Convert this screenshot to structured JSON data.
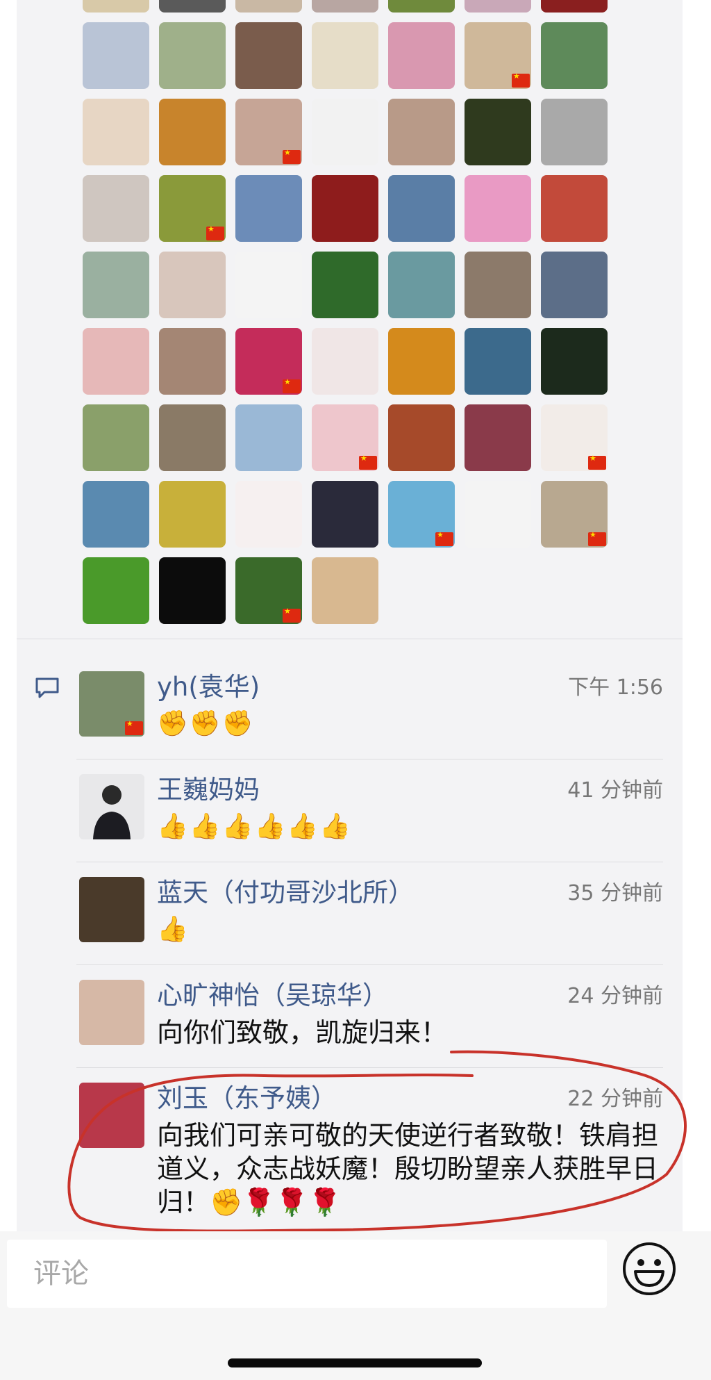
{
  "likes": {
    "avatars": [
      {
        "icon": "user-avatar",
        "bg": "#d8c9a8",
        "flag": false
      },
      {
        "icon": "user-avatar",
        "bg": "#5a5a5a",
        "flag": false
      },
      {
        "icon": "user-avatar",
        "bg": "#c9b8a4",
        "flag": false
      },
      {
        "icon": "user-avatar",
        "bg": "#b8a6a2",
        "flag": false
      },
      {
        "icon": "user-avatar",
        "bg": "#6f8a3c",
        "flag": false
      },
      {
        "icon": "user-avatar",
        "bg": "#c9a8b8",
        "flag": false
      },
      {
        "icon": "user-avatar",
        "bg": "#8a1f1f",
        "flag": false
      },
      {
        "icon": "user-avatar",
        "bg": "#b9c4d6",
        "flag": false
      },
      {
        "icon": "user-avatar",
        "bg": "#9fb08a",
        "flag": false
      },
      {
        "icon": "user-avatar",
        "bg": "#7a5c4c",
        "flag": false
      },
      {
        "icon": "user-avatar",
        "bg": "#e6ddc8",
        "flag": false
      },
      {
        "icon": "user-avatar",
        "bg": "#d998b0",
        "flag": false
      },
      {
        "icon": "user-avatar",
        "bg": "#cfb89a",
        "flag": true
      },
      {
        "icon": "user-avatar",
        "bg": "#5e8a5a",
        "flag": false
      },
      {
        "icon": "user-avatar",
        "bg": "#e7d6c4",
        "flag": false
      },
      {
        "icon": "user-avatar",
        "bg": "#c8842c",
        "flag": false
      },
      {
        "icon": "user-avatar",
        "bg": "#c6a596",
        "flag": true
      },
      {
        "icon": "user-avatar",
        "bg": "#f2f2f2",
        "flag": false
      },
      {
        "icon": "user-avatar",
        "bg": "#b89a88",
        "flag": false
      },
      {
        "icon": "user-avatar",
        "bg": "#2f3a1e",
        "flag": false
      },
      {
        "icon": "user-avatar",
        "bg": "#a9a9a9",
        "flag": false
      },
      {
        "icon": "user-avatar",
        "bg": "#cfc6c0",
        "flag": false
      },
      {
        "icon": "user-avatar",
        "bg": "#8a9a3a",
        "flag": true
      },
      {
        "icon": "user-avatar",
        "bg": "#6c8cb8",
        "flag": false
      },
      {
        "icon": "user-avatar",
        "bg": "#8e1c1c",
        "flag": false
      },
      {
        "icon": "user-avatar",
        "bg": "#5a7ea6",
        "flag": false
      },
      {
        "icon": "user-avatar",
        "bg": "#e99ac4",
        "flag": false
      },
      {
        "icon": "user-avatar",
        "bg": "#c24a3a",
        "flag": false
      },
      {
        "icon": "user-avatar",
        "bg": "#9ab0a0",
        "flag": false
      },
      {
        "icon": "user-avatar",
        "bg": "#d8c6bc",
        "flag": false
      },
      {
        "icon": "user-avatar",
        "bg": "#f4f4f4",
        "flag": false
      },
      {
        "icon": "user-avatar",
        "bg": "#2f6a2a",
        "flag": false
      },
      {
        "icon": "user-avatar",
        "bg": "#6a9aa0",
        "flag": false
      },
      {
        "icon": "user-avatar",
        "bg": "#8c7a6a",
        "flag": false
      },
      {
        "icon": "user-avatar",
        "bg": "#5c6e88",
        "flag": false
      },
      {
        "icon": "user-avatar",
        "bg": "#e6b8b8",
        "flag": false
      },
      {
        "icon": "user-avatar",
        "bg": "#a48674",
        "flag": false
      },
      {
        "icon": "user-avatar",
        "bg": "#c42c5a",
        "flag": true
      },
      {
        "icon": "user-avatar",
        "bg": "#f0e6e6",
        "flag": false
      },
      {
        "icon": "user-avatar",
        "bg": "#d48a1c",
        "flag": false
      },
      {
        "icon": "user-avatar",
        "bg": "#3c6a8c",
        "flag": false
      },
      {
        "icon": "user-avatar",
        "bg": "#1c2a1c",
        "flag": false
      },
      {
        "icon": "user-avatar",
        "bg": "#8aa06a",
        "flag": false
      },
      {
        "icon": "user-avatar",
        "bg": "#8a7a66",
        "flag": false
      },
      {
        "icon": "user-avatar",
        "bg": "#9ab8d6",
        "flag": false
      },
      {
        "icon": "user-avatar",
        "bg": "#eec6cc",
        "flag": true
      },
      {
        "icon": "user-avatar",
        "bg": "#a64a2a",
        "flag": false
      },
      {
        "icon": "user-avatar",
        "bg": "#8a3a4a",
        "flag": false
      },
      {
        "icon": "user-avatar",
        "bg": "#f2ece8",
        "flag": true
      },
      {
        "icon": "user-avatar",
        "bg": "#5a8ab0",
        "flag": false
      },
      {
        "icon": "user-avatar",
        "bg": "#c8b03a",
        "flag": false
      },
      {
        "icon": "user-avatar",
        "bg": "#f6f0f0",
        "flag": false
      },
      {
        "icon": "user-avatar",
        "bg": "#2a2a3a",
        "flag": false
      },
      {
        "icon": "user-avatar",
        "bg": "#6ab0d6",
        "flag": true
      },
      {
        "icon": "user-avatar",
        "bg": "#f4f4f4",
        "flag": false
      },
      {
        "icon": "user-avatar",
        "bg": "#b8a890",
        "flag": true
      },
      {
        "icon": "user-avatar",
        "bg": "#4a9a2a",
        "flag": false
      },
      {
        "icon": "user-avatar",
        "bg": "#0c0c0c",
        "flag": false
      },
      {
        "icon": "user-avatar",
        "bg": "#3a6a2a",
        "flag": true
      },
      {
        "icon": "user-avatar",
        "bg": "#d8b890",
        "flag": false
      }
    ]
  },
  "comments": [
    {
      "name": "yh(袁华)",
      "time": "下午 1:56",
      "text": "✊✊✊",
      "is_emoji": true,
      "avatar_bg": "#7a8c6a",
      "flag": true
    },
    {
      "name": "王巍妈妈",
      "time": "41 分钟前",
      "text": "👍👍👍👍👍👍",
      "is_emoji": true,
      "avatar_bg": "#e8e8ea",
      "flag": false
    },
    {
      "name": "蓝天（付功哥沙北所）",
      "time": "35 分钟前",
      "text": "👍",
      "is_emoji": true,
      "avatar_bg": "#4a3a2a",
      "flag": false
    },
    {
      "name": "心旷神怡（吴琼华）",
      "time": "24 分钟前",
      "text": "向你们致敬，凯旋归来！",
      "is_emoji": false,
      "avatar_bg": "#d6b8a6",
      "flag": false
    },
    {
      "name": "刘玉（东予姨）",
      "time": "22 分钟前",
      "text": "向我们可亲可敬的天使逆行者致敬！铁肩担道义，众志战妖魔！殷切盼望亲人获胜早日归！✊🌹🌹🌹",
      "is_emoji": false,
      "avatar_bg": "#b8384a",
      "flag": false
    }
  ],
  "input": {
    "placeholder": "评论"
  },
  "icons": {
    "comment": "comment-bubble-icon",
    "emoji": "smiley-face-icon"
  },
  "colors": {
    "name": "#3f5a8a",
    "annotation": "#c8322a",
    "flag": "#de2910"
  }
}
